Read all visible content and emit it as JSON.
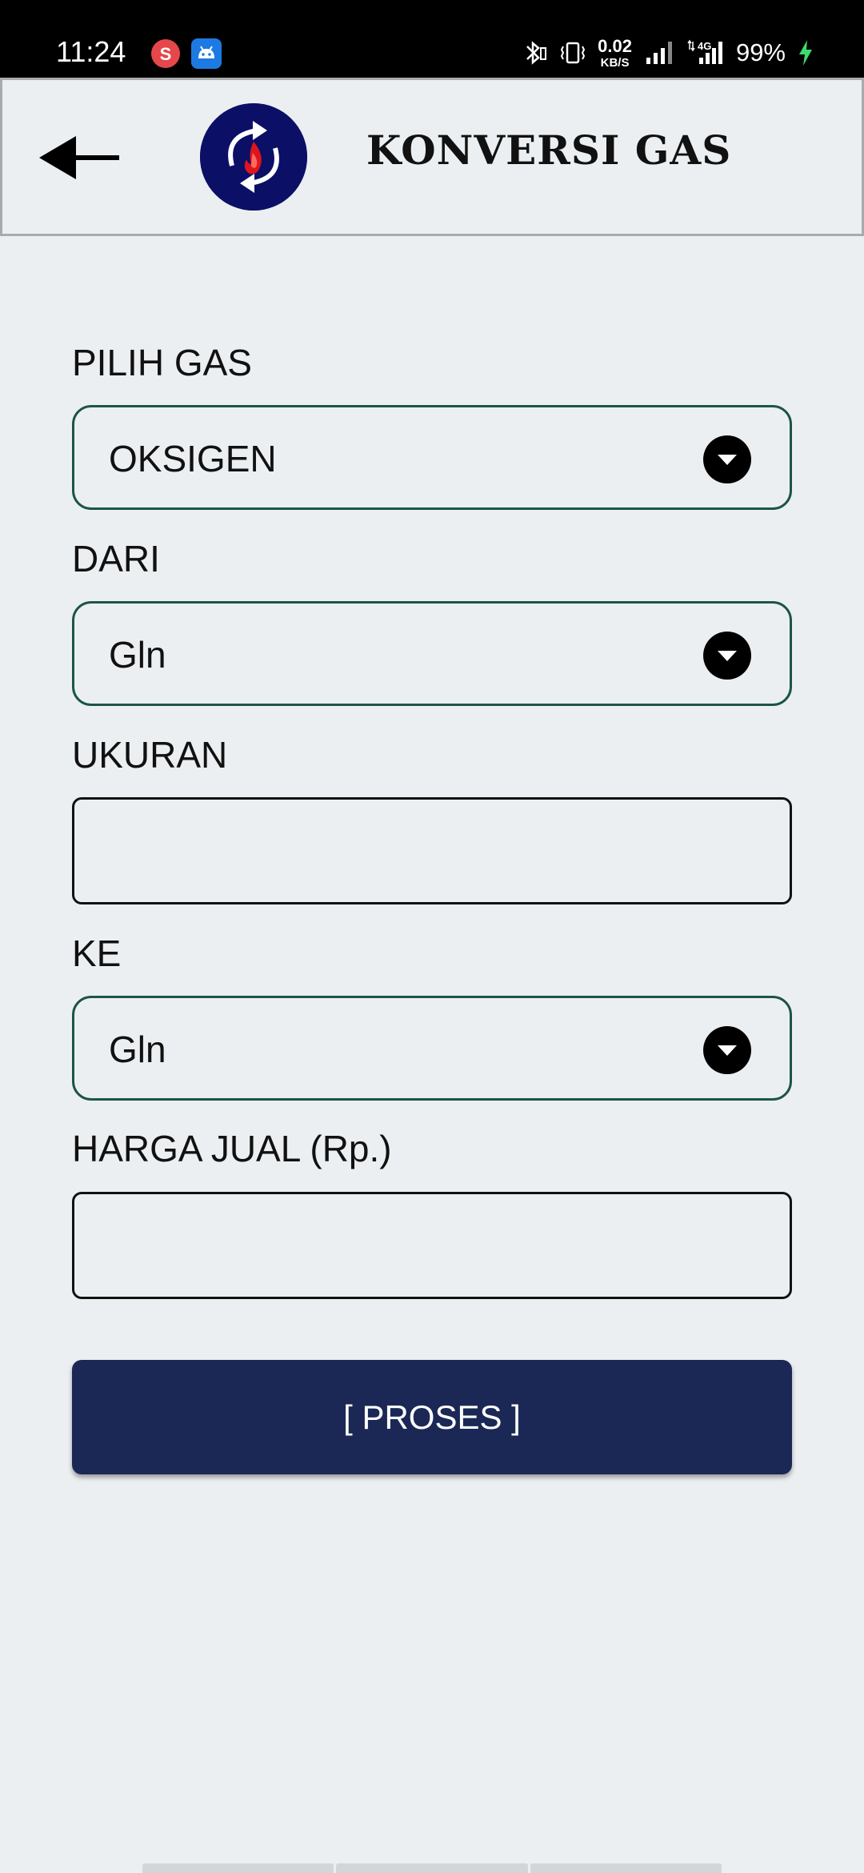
{
  "status_bar": {
    "time": "11:24",
    "net_speed_value": "0.02",
    "net_speed_unit": "KB/S",
    "network_type": "4G",
    "battery_percent": "99%",
    "notification_icons": [
      "s-app-icon",
      "android-icon"
    ]
  },
  "app_bar": {
    "title": "KONVERSI GAS",
    "back_icon": "arrow-left-icon",
    "logo_icon": "gas-conversion-logo"
  },
  "form": {
    "gas": {
      "label": "PILIH GAS",
      "value": "OKSIGEN"
    },
    "from_unit": {
      "label": "DARI",
      "value": "Gln"
    },
    "size": {
      "label": "UKURAN",
      "value": "",
      "placeholder": ""
    },
    "to_unit": {
      "label": "KE",
      "value": "Gln"
    },
    "price": {
      "label": "HARGA JUAL (Rp.)",
      "value": "",
      "placeholder": ""
    },
    "submit_label": "[ PROSES ]"
  },
  "colors": {
    "background": "#eceff1",
    "status_bar": "#000000",
    "dropdown_border": "#1c5449",
    "button": "#1b2856",
    "logo": "#0b1066",
    "flame": "#e0141e"
  }
}
